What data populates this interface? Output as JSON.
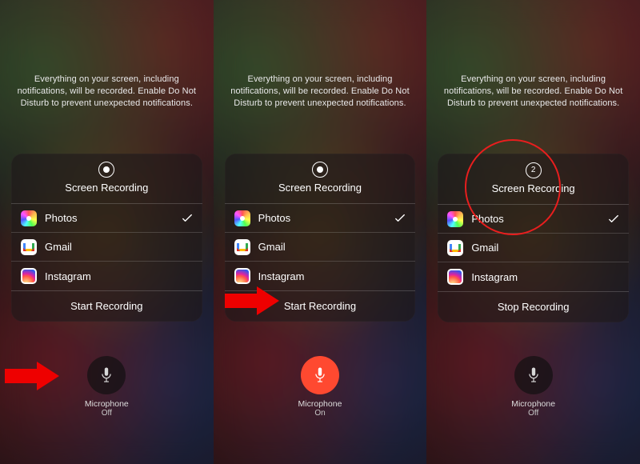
{
  "info_text": "Everything on your screen, including notifications, will be recorded. Enable Do Not Disturb to prevent unexpected notifications.",
  "card_title": "Screen Recording",
  "apps": [
    {
      "label": "Photos",
      "icon": "photos",
      "selected": true
    },
    {
      "label": "Gmail",
      "icon": "gmail",
      "selected": false
    },
    {
      "label": "Instagram",
      "icon": "instagram",
      "selected": false
    }
  ],
  "mic_label": "Microphone",
  "panels": [
    {
      "action_label": "Start Recording",
      "mic_state": "Off",
      "mic_on": false,
      "countdown": null
    },
    {
      "action_label": "Start Recording",
      "mic_state": "On",
      "mic_on": true,
      "countdown": null
    },
    {
      "action_label": "Stop Recording",
      "mic_state": "Off",
      "mic_on": false,
      "countdown": "2"
    }
  ],
  "annotations": {
    "panel0_arrow_target": "microphone-button",
    "panel1_arrow_target": "start-recording-button",
    "panel2_circle_target": "screen-recording-header"
  }
}
